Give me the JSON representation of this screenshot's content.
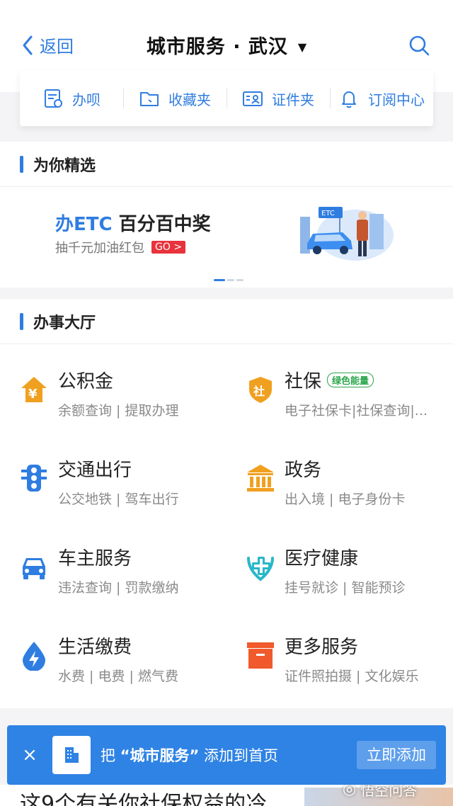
{
  "header": {
    "back_label": "返回",
    "title": "城市服务 · 武汉",
    "title_arrow": "▼"
  },
  "quick_bar": [
    {
      "label": "办呗",
      "icon": "receipt-icon"
    },
    {
      "label": "收藏夹",
      "icon": "folder-icon"
    },
    {
      "label": "证件夹",
      "icon": "id-card-icon"
    },
    {
      "label": "订阅中心",
      "icon": "bell-icon"
    }
  ],
  "featured": {
    "heading": "为你精选",
    "banner": {
      "title_highlight": "办ETC",
      "title_rest": " 百分百中奖",
      "subtitle": "抽千元加油红包",
      "go_label": "GO >",
      "etc_sign": "ETC"
    }
  },
  "hall": {
    "heading": "办事大厅",
    "services": [
      {
        "name": "公积金",
        "desc": "余额查询 | 提取办理",
        "icon": "yen-house-icon"
      },
      {
        "name": "社保",
        "badge": "绿色能量",
        "desc": "电子社保卡|社保查询|...",
        "icon": "shield-icon"
      },
      {
        "name": "交通出行",
        "desc": "公交地铁 | 驾车出行",
        "icon": "traffic-light-icon"
      },
      {
        "name": "政务",
        "desc": "出入境 | 电子身份卡",
        "icon": "government-building-icon"
      },
      {
        "name": "车主服务",
        "desc": "违法查询 | 罚款缴纳",
        "icon": "car-icon"
      },
      {
        "name": "医疗健康",
        "desc": "挂号就诊 | 智能预诊",
        "icon": "stethoscope-icon"
      },
      {
        "name": "生活缴费",
        "desc": "水费 | 电费 | 燃气费",
        "icon": "lightning-drop-icon"
      },
      {
        "name": "更多服务",
        "desc": "证件照拍摄 | 文化娱乐",
        "icon": "box-icon"
      }
    ]
  },
  "toast": {
    "close": "×",
    "msg_prefix": "把 ",
    "msg_name": "“城市服务”",
    "msg_suffix": " 添加到首页",
    "add_label": "立即添加"
  },
  "feed": {
    "article_title": "这9个有关你社保权益的冷"
  },
  "watermark": "悟空问答",
  "colors": {
    "accent": "#2f7de1",
    "toast": "#2f83e4",
    "go_red": "#e8323c",
    "badge_green": "#2aa74a",
    "icon_orange": "#f0a020"
  }
}
